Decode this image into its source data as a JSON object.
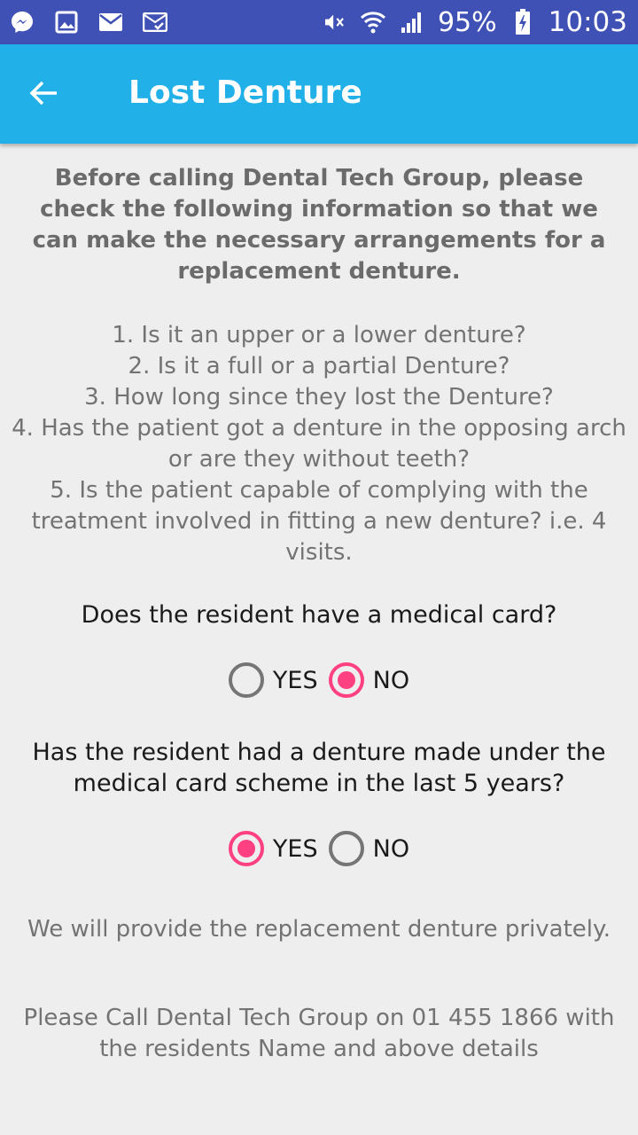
{
  "status_bar": {
    "battery_percent": "95%",
    "time": "10:03",
    "icons": [
      "messenger-icon",
      "gallery-icon",
      "email-icon",
      "mail-check-icon",
      "mute-icon",
      "wifi-icon",
      "signal-icon",
      "battery-charging-icon"
    ]
  },
  "app_bar": {
    "title": "Lost Denture",
    "back_icon": "arrow-back-icon"
  },
  "content": {
    "intro": "Before calling Dental Tech Group, please check the following information so that we can make the necessary arrangements for a replacement denture.",
    "steps": [
      "1. Is it an upper or a lower denture?",
      "2. Is it a full or a partial Denture?",
      "3. How long since they lost the Denture?",
      "4. Has the patient got a denture in the opposing arch or are they without teeth?",
      "5. Is the patient capable of complying with the treatment involved in fitting a new denture? i.e. 4 visits."
    ],
    "question1": {
      "text": "Does the resident have a medical card?",
      "yes_label": "YES",
      "no_label": "NO",
      "selected": "NO"
    },
    "question2": {
      "text": "Has the resident had a denture made under the medical card scheme in the last 5 years?",
      "yes_label": "YES",
      "no_label": "NO",
      "selected": "YES"
    },
    "note": "We will provide the replacement denture privately.",
    "call": "Please Call Dental Tech Group on 01 455 1866 with the residents Name and above details"
  },
  "colors": {
    "status_bar": "#3f51b5",
    "app_bar": "#22b0e8",
    "accent": "#ff4081",
    "background": "#eeeeee"
  }
}
